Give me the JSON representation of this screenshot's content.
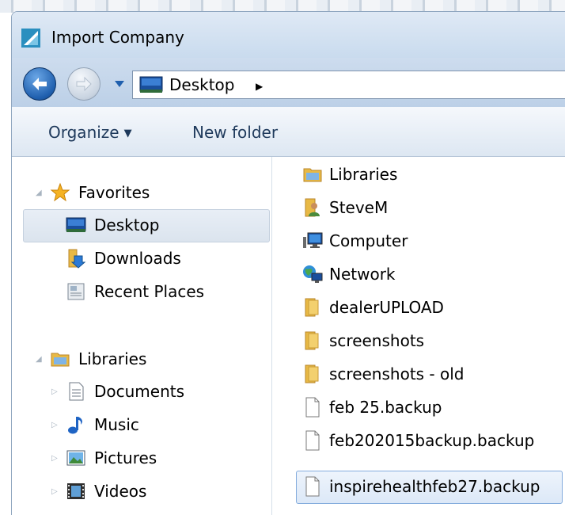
{
  "window": {
    "title": "Import Company"
  },
  "address_bar": {
    "location": "Desktop"
  },
  "toolbar": {
    "organize_label": "Organize",
    "new_folder_label": "New folder"
  },
  "nav_pane": {
    "favorites_label": "Favorites",
    "favorites_items": [
      {
        "label": "Desktop",
        "icon": "desktop-icon",
        "selected": true
      },
      {
        "label": "Downloads",
        "icon": "downloads-folder-icon"
      },
      {
        "label": "Recent Places",
        "icon": "recent-places-icon"
      }
    ],
    "libraries_label": "Libraries",
    "libraries_items": [
      {
        "label": "Documents",
        "icon": "documents-icon"
      },
      {
        "label": "Music",
        "icon": "music-icon"
      },
      {
        "label": "Pictures",
        "icon": "pictures-icon"
      },
      {
        "label": "Videos",
        "icon": "videos-icon"
      }
    ]
  },
  "files": [
    {
      "name": "Libraries",
      "icon": "libraries-icon"
    },
    {
      "name": "SteveM",
      "icon": "user-folder-icon"
    },
    {
      "name": "Computer",
      "icon": "computer-icon"
    },
    {
      "name": "Network",
      "icon": "network-icon"
    },
    {
      "name": "dealerUPLOAD",
      "icon": "folder-icon"
    },
    {
      "name": "screenshots",
      "icon": "folder-icon"
    },
    {
      "name": "screenshots - old",
      "icon": "folder-icon"
    },
    {
      "name": "feb 25.backup",
      "icon": "file-icon"
    },
    {
      "name": "feb202015backup.backup",
      "icon": "file-icon"
    },
    {
      "name": "inspirehealthfeb27.backup",
      "icon": "file-icon",
      "selected": true
    }
  ],
  "colors": {
    "title_bar": "#c9dbee",
    "selection": "#dce8f7",
    "folder": "#e8b945"
  }
}
